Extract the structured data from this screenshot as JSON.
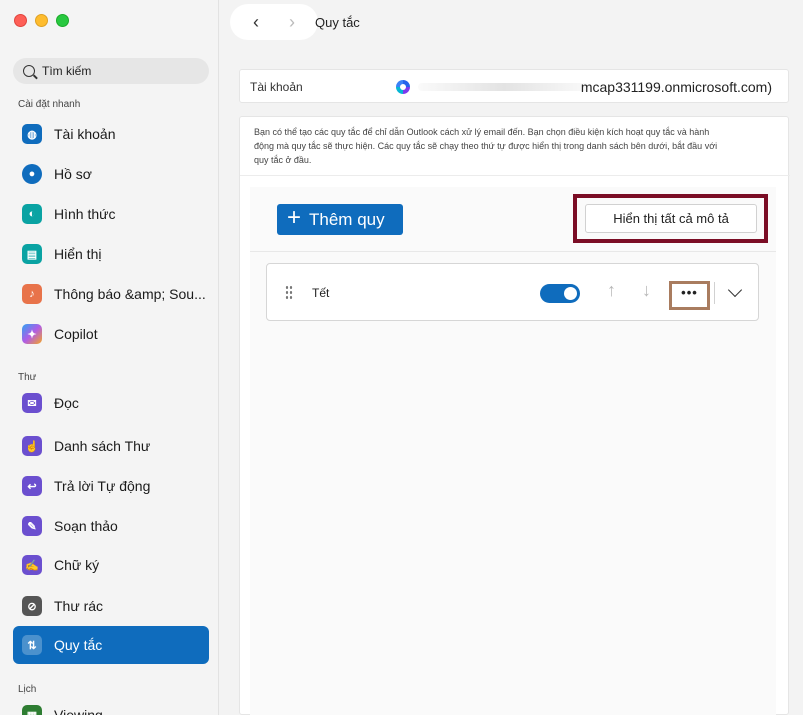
{
  "sidebar": {
    "search_placeholder": "Tìm kiếm",
    "quick_settings_label": "Cài đặt nhanh",
    "mail_label": "Thư",
    "calendar_label": "Lịch",
    "quick_items": [
      {
        "label": "Tài khoản",
        "icon": "globe-icon",
        "color": "#0f6cbd"
      },
      {
        "label": "Hồ sơ",
        "icon": "profile-icon",
        "color": "#0f6cbd"
      },
      {
        "label": "Hình thức",
        "icon": "palette-icon",
        "color": "#0aa3a3"
      },
      {
        "label": "Hiển thị",
        "icon": "layout-icon",
        "color": "#0aa3a3"
      },
      {
        "label": "Thông báo &amp; Sou...",
        "icon": "bell-icon",
        "color": "#e8734a"
      },
      {
        "label": "Copilot",
        "icon": "copilot-icon",
        "color": "#7b61ff"
      }
    ],
    "mail_items": [
      {
        "label": "Đọc",
        "icon": "envelope-open-icon",
        "color": "#6b4fcf",
        "active": false
      },
      {
        "label": "Danh sách Thư",
        "icon": "touch-icon",
        "color": "#6b4fcf",
        "active": false
      },
      {
        "label": "Trả lời Tự động",
        "icon": "reply-icon",
        "color": "#6b4fcf",
        "active": false
      },
      {
        "label": "Soạn thảo",
        "icon": "compose-icon",
        "color": "#6b4fcf",
        "active": false
      },
      {
        "label": "Chữ ký",
        "icon": "signature-icon",
        "color": "#6b4fcf",
        "active": false
      },
      {
        "label": "Thư rác",
        "icon": "junk-icon",
        "color": "#555555",
        "active": false
      },
      {
        "label": "Quy tắc",
        "icon": "rules-icon",
        "color": "#0f6cbd",
        "active": true
      }
    ],
    "calendar_items": [
      {
        "label": "Viewing",
        "icon": "calendar-icon",
        "color": "#2e7d32"
      }
    ]
  },
  "header": {
    "title": "Quy tắc",
    "back": "‹",
    "forward": "›"
  },
  "account": {
    "label": "Tài khoản",
    "email": "mcap331199.onmicrosoft.com)"
  },
  "rules": {
    "description": "Bạn có thể tạo các quy tắc để chỉ dẫn Outlook cách xử lý email đến. Bạn chọn điều kiện kích hoạt quy tắc và hành động mà quy tắc sẽ thực hiện. Các quy tắc sẽ chạy theo thứ tự được hiển thị trong danh sách bên dưới, bắt đầu với quy tắc ở đầu.",
    "add_label": "Thêm quy",
    "show_all_label": "Hiển thị tất cả mô tả",
    "items": [
      {
        "name": "Tết",
        "enabled": true
      }
    ],
    "more_label": "•••"
  },
  "colors": {
    "accent": "#0f6cbd",
    "highlight_frame": "#7b0d25",
    "more_frame": "#a97c5f"
  }
}
